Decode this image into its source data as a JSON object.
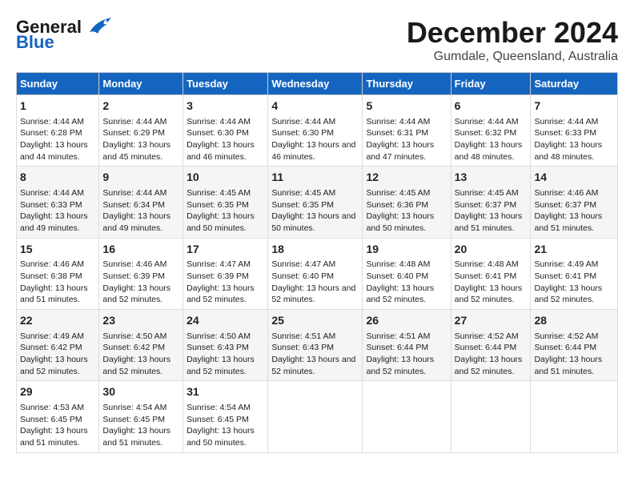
{
  "logo": {
    "line1": "General",
    "line2": "Blue"
  },
  "title": "December 2024",
  "subtitle": "Gumdale, Queensland, Australia",
  "headers": [
    "Sunday",
    "Monday",
    "Tuesday",
    "Wednesday",
    "Thursday",
    "Friday",
    "Saturday"
  ],
  "rows": [
    [
      {
        "day": "1",
        "sunrise": "4:44 AM",
        "sunset": "6:28 PM",
        "daylight": "13 hours and 44 minutes."
      },
      {
        "day": "2",
        "sunrise": "4:44 AM",
        "sunset": "6:29 PM",
        "daylight": "13 hours and 45 minutes."
      },
      {
        "day": "3",
        "sunrise": "4:44 AM",
        "sunset": "6:30 PM",
        "daylight": "13 hours and 46 minutes."
      },
      {
        "day": "4",
        "sunrise": "4:44 AM",
        "sunset": "6:30 PM",
        "daylight": "13 hours and 46 minutes."
      },
      {
        "day": "5",
        "sunrise": "4:44 AM",
        "sunset": "6:31 PM",
        "daylight": "13 hours and 47 minutes."
      },
      {
        "day": "6",
        "sunrise": "4:44 AM",
        "sunset": "6:32 PM",
        "daylight": "13 hours and 48 minutes."
      },
      {
        "day": "7",
        "sunrise": "4:44 AM",
        "sunset": "6:33 PM",
        "daylight": "13 hours and 48 minutes."
      }
    ],
    [
      {
        "day": "8",
        "sunrise": "4:44 AM",
        "sunset": "6:33 PM",
        "daylight": "13 hours and 49 minutes."
      },
      {
        "day": "9",
        "sunrise": "4:44 AM",
        "sunset": "6:34 PM",
        "daylight": "13 hours and 49 minutes."
      },
      {
        "day": "10",
        "sunrise": "4:45 AM",
        "sunset": "6:35 PM",
        "daylight": "13 hours and 50 minutes."
      },
      {
        "day": "11",
        "sunrise": "4:45 AM",
        "sunset": "6:35 PM",
        "daylight": "13 hours and 50 minutes."
      },
      {
        "day": "12",
        "sunrise": "4:45 AM",
        "sunset": "6:36 PM",
        "daylight": "13 hours and 50 minutes."
      },
      {
        "day": "13",
        "sunrise": "4:45 AM",
        "sunset": "6:37 PM",
        "daylight": "13 hours and 51 minutes."
      },
      {
        "day": "14",
        "sunrise": "4:46 AM",
        "sunset": "6:37 PM",
        "daylight": "13 hours and 51 minutes."
      }
    ],
    [
      {
        "day": "15",
        "sunrise": "4:46 AM",
        "sunset": "6:38 PM",
        "daylight": "13 hours and 51 minutes."
      },
      {
        "day": "16",
        "sunrise": "4:46 AM",
        "sunset": "6:39 PM",
        "daylight": "13 hours and 52 minutes."
      },
      {
        "day": "17",
        "sunrise": "4:47 AM",
        "sunset": "6:39 PM",
        "daylight": "13 hours and 52 minutes."
      },
      {
        "day": "18",
        "sunrise": "4:47 AM",
        "sunset": "6:40 PM",
        "daylight": "13 hours and 52 minutes."
      },
      {
        "day": "19",
        "sunrise": "4:48 AM",
        "sunset": "6:40 PM",
        "daylight": "13 hours and 52 minutes."
      },
      {
        "day": "20",
        "sunrise": "4:48 AM",
        "sunset": "6:41 PM",
        "daylight": "13 hours and 52 minutes."
      },
      {
        "day": "21",
        "sunrise": "4:49 AM",
        "sunset": "6:41 PM",
        "daylight": "13 hours and 52 minutes."
      }
    ],
    [
      {
        "day": "22",
        "sunrise": "4:49 AM",
        "sunset": "6:42 PM",
        "daylight": "13 hours and 52 minutes."
      },
      {
        "day": "23",
        "sunrise": "4:50 AM",
        "sunset": "6:42 PM",
        "daylight": "13 hours and 52 minutes."
      },
      {
        "day": "24",
        "sunrise": "4:50 AM",
        "sunset": "6:43 PM",
        "daylight": "13 hours and 52 minutes."
      },
      {
        "day": "25",
        "sunrise": "4:51 AM",
        "sunset": "6:43 PM",
        "daylight": "13 hours and 52 minutes."
      },
      {
        "day": "26",
        "sunrise": "4:51 AM",
        "sunset": "6:44 PM",
        "daylight": "13 hours and 52 minutes."
      },
      {
        "day": "27",
        "sunrise": "4:52 AM",
        "sunset": "6:44 PM",
        "daylight": "13 hours and 52 minutes."
      },
      {
        "day": "28",
        "sunrise": "4:52 AM",
        "sunset": "6:44 PM",
        "daylight": "13 hours and 51 minutes."
      }
    ],
    [
      {
        "day": "29",
        "sunrise": "4:53 AM",
        "sunset": "6:45 PM",
        "daylight": "13 hours and 51 minutes."
      },
      {
        "day": "30",
        "sunrise": "4:54 AM",
        "sunset": "6:45 PM",
        "daylight": "13 hours and 51 minutes."
      },
      {
        "day": "31",
        "sunrise": "4:54 AM",
        "sunset": "6:45 PM",
        "daylight": "13 hours and 50 minutes."
      },
      null,
      null,
      null,
      null
    ]
  ]
}
